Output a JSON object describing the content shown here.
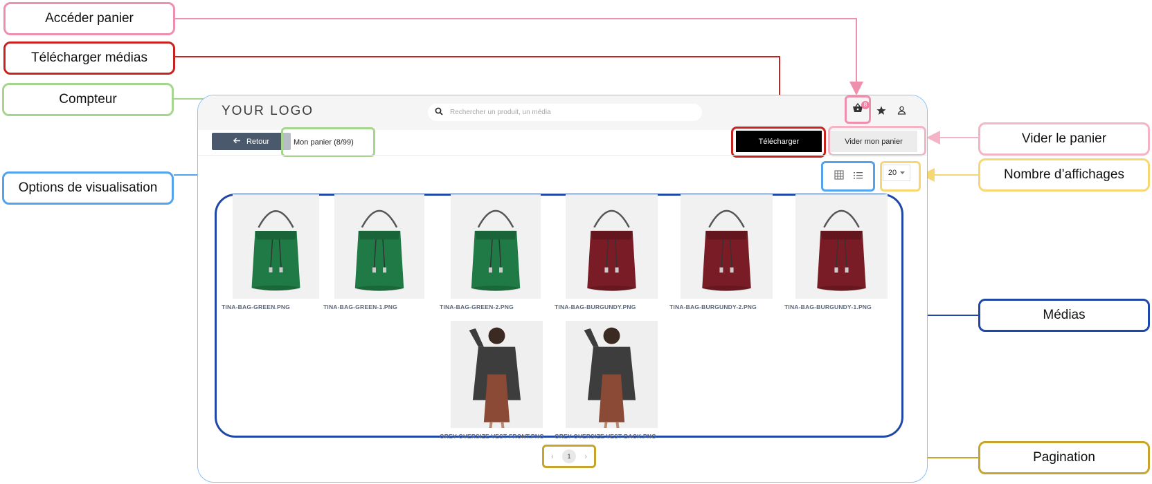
{
  "annotations": {
    "acceder_panier": "Accéder panier",
    "telecharger_medias": "Télécharger médias",
    "compteur": "Compteur",
    "options_visualisation": "Options de visualisation",
    "vider_panier": "Vider le panier",
    "nombre_affichages": "Nombre d’affichages",
    "medias": "Médias",
    "pagination": "Pagination"
  },
  "header": {
    "logo": "YOUR LOGO",
    "search_placeholder": "Rechercher un produit, un média",
    "cart_count": "8"
  },
  "toolbar": {
    "back_label": "Retour",
    "counter_label": "Mon panier  (8/99)",
    "download_label": "Télécharger",
    "clear_label": "Vider mon panier",
    "per_page_value": "20"
  },
  "media": [
    {
      "caption": "TINA-BAG-GREEN.PNG",
      "kind": "bag",
      "color": "#1f7a45"
    },
    {
      "caption": "TINA-BAG-GREEN-1.PNG",
      "kind": "bag",
      "color": "#1f7a45"
    },
    {
      "caption": "TINA-BAG-GREEN-2.PNG",
      "kind": "bag",
      "color": "#1f7a45"
    },
    {
      "caption": "TINA-BAG-BURGUNDY.PNG",
      "kind": "bag",
      "color": "#7a1c25"
    },
    {
      "caption": "TINA-BAG-BURGUNDY-2.PNG",
      "kind": "bag",
      "color": "#7a1c25"
    },
    {
      "caption": "TINA-BAG-BURGUNDY-1.PNG",
      "kind": "bag",
      "color": "#7a1c25"
    },
    {
      "caption": "GREY OVERSIZE VEST FRONT.PNG",
      "kind": "person",
      "color": "#3c3c3c"
    },
    {
      "caption": "GREY OVERSIZE VEST BACK.PNG",
      "kind": "person",
      "color": "#3c3c3c"
    }
  ],
  "pagination": {
    "prev": "‹",
    "current": "1",
    "next": "›"
  },
  "colors": {
    "accent_pink": "#ef8fae",
    "accent_red": "#c8231e",
    "accent_green": "#a6d58e",
    "accent_blue": "#52a3ec",
    "accent_navy": "#1f47a7",
    "accent_gold": "#c7a42b",
    "accent_yellow": "#f7d774"
  }
}
